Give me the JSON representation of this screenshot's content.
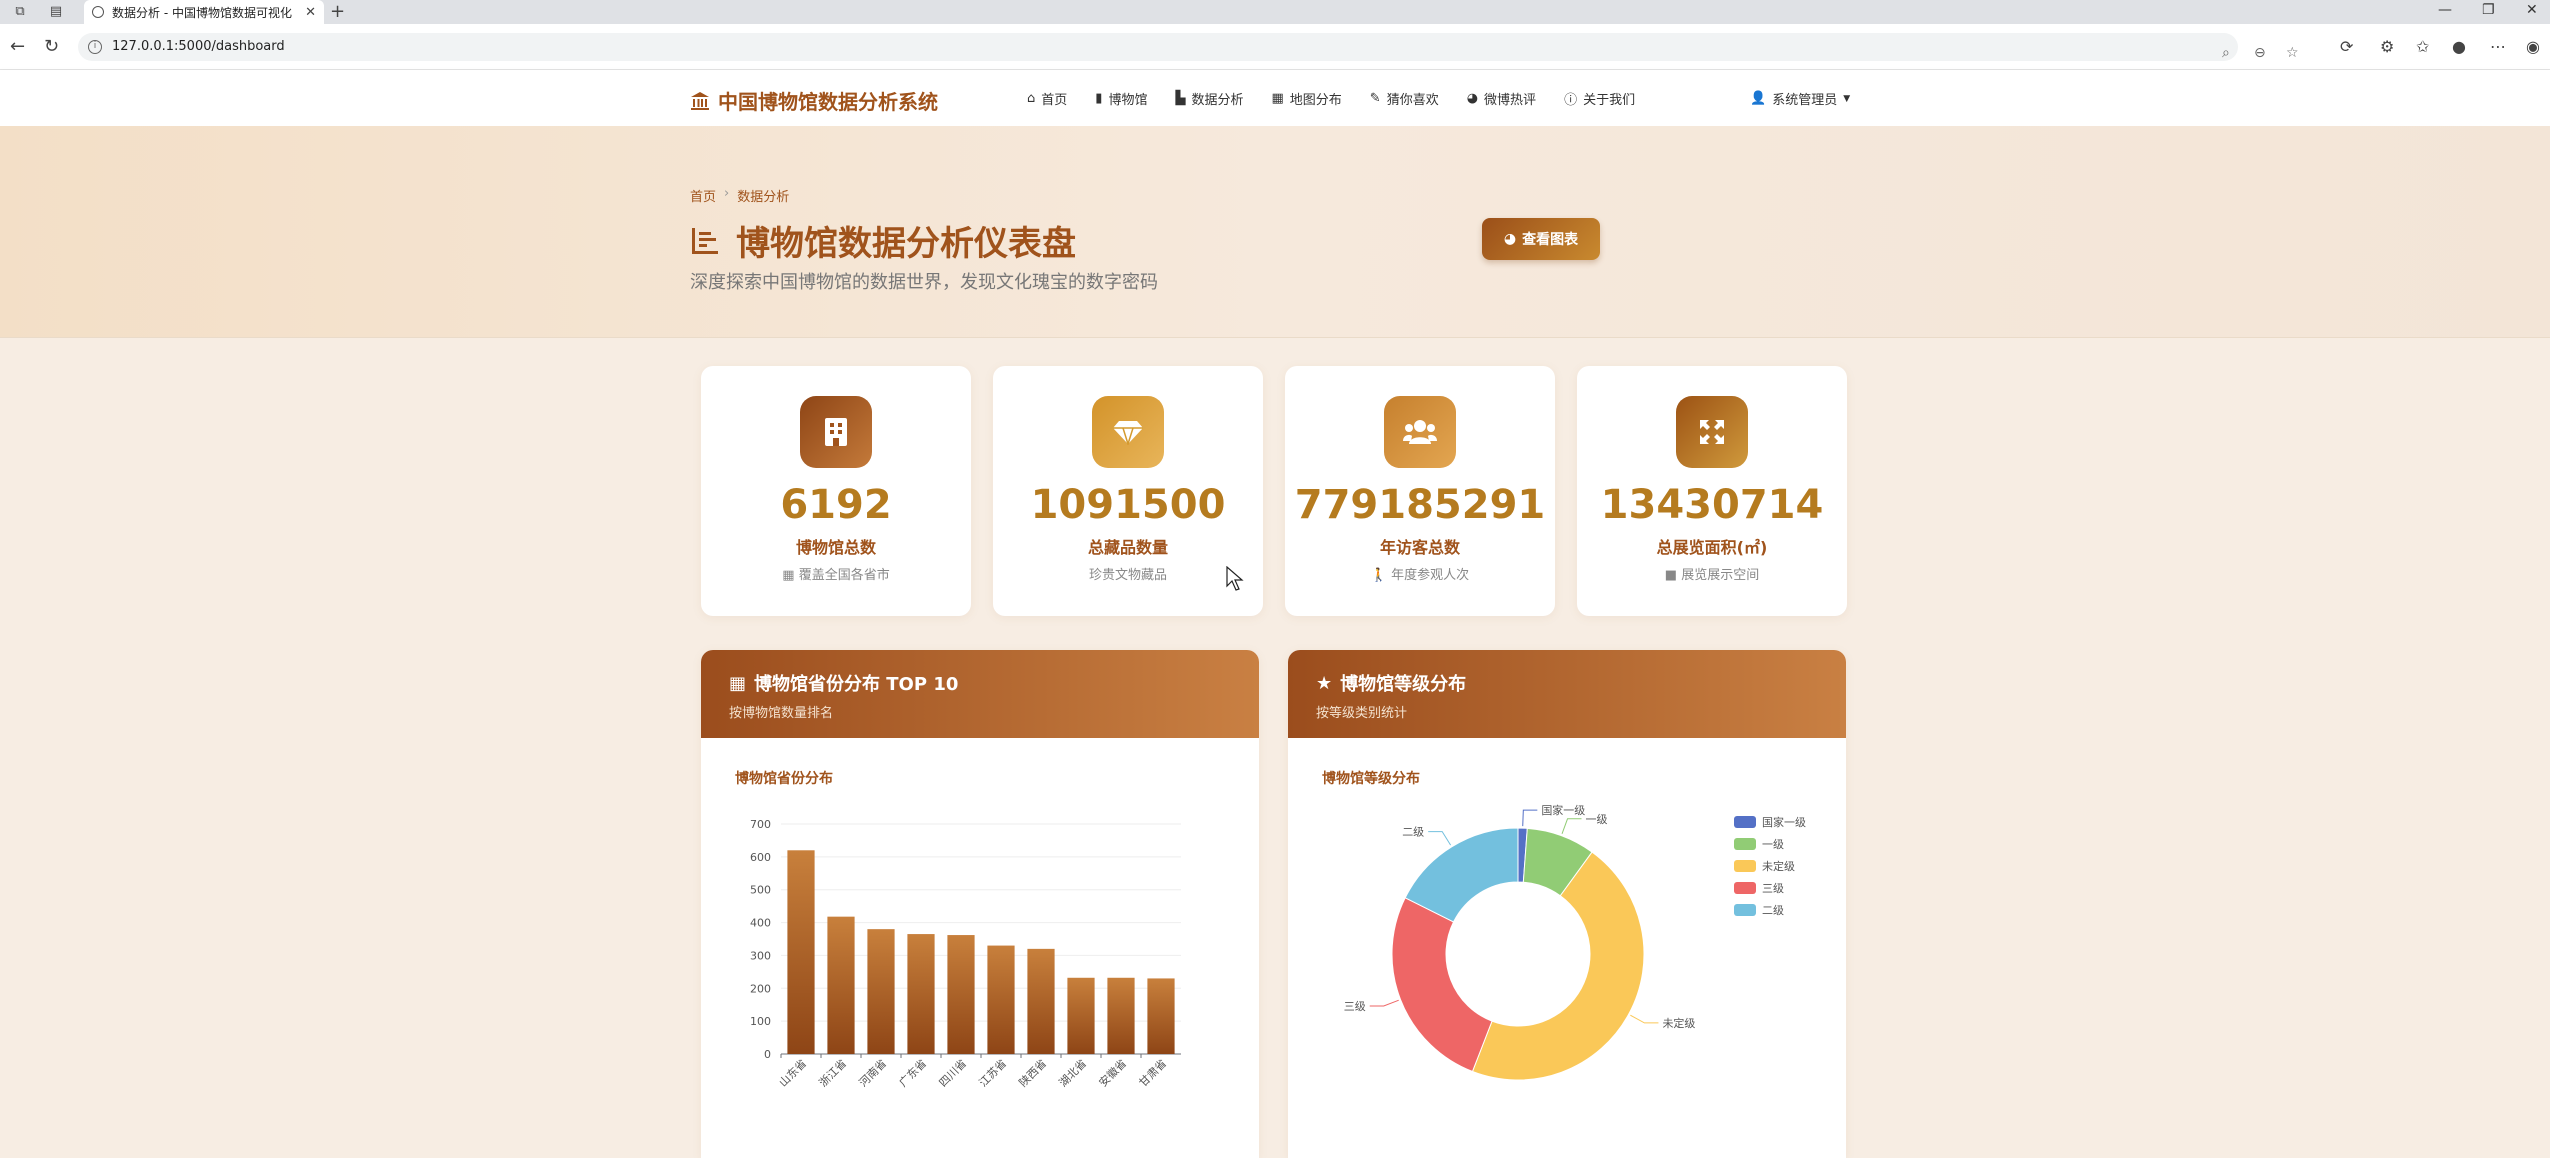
{
  "browser": {
    "tab_title": "数据分析 - 中国博物馆数据可视化",
    "url": "127.0.0.1:5000/dashboard"
  },
  "site": {
    "brand": "中国博物馆数据分析系统",
    "nav": [
      "首页",
      "博物馆",
      "数据分析",
      "地图分布",
      "猜你喜欢",
      "微博热评",
      "关于我们"
    ],
    "user": "系统管理员"
  },
  "hero": {
    "breadcrumb_home": "首页",
    "breadcrumb_current": "数据分析",
    "title": "博物馆数据分析仪表盘",
    "subtitle": "深度探索中国博物馆的数据世界，发现文化瑰宝的数字密码",
    "view_button": "查看图表"
  },
  "stats": [
    {
      "value": "6192",
      "label": "博物馆总数",
      "note": "覆盖全国各省市",
      "icon": "building-icon",
      "color": "#a0531c"
    },
    {
      "value": "1091500",
      "label": "总藏品数量",
      "note": "珍贵文物藏品",
      "icon": "gem-icon",
      "color": "#d49a2f"
    },
    {
      "value": "779185291",
      "label": "年访客总数",
      "note": "年度参观人次",
      "icon": "users-icon",
      "color": "#d08a35"
    },
    {
      "value": "13430714",
      "label": "总展览面积(㎡)",
      "note": "展览展示空间",
      "icon": "expand-icon",
      "color": "#b06a1a"
    }
  ],
  "panels": {
    "province": {
      "title": "博物馆省份分布 TOP 10",
      "subtitle": "按博物馆数量排名",
      "chart_title": "博物馆省份分布"
    },
    "level": {
      "title": "博物馆等级分布",
      "subtitle": "按等级类别统计",
      "chart_title": "博物馆等级分布"
    }
  },
  "chart_data": [
    {
      "type": "bar",
      "title": "博物馆省份分布",
      "categories": [
        "山东省",
        "浙江省",
        "河南省",
        "广东省",
        "四川省",
        "江苏省",
        "陕西省",
        "湖北省",
        "安徽省",
        "甘肃省"
      ],
      "values": [
        620,
        418,
        380,
        365,
        362,
        330,
        320,
        232,
        232,
        230
      ],
      "ylim": [
        0,
        700
      ],
      "yticks": [
        0,
        100,
        200,
        300,
        400,
        500,
        600,
        700
      ],
      "grid": true,
      "color": "#b5651d"
    },
    {
      "type": "pie",
      "title": "博物馆等级分布",
      "legend_position": "top-right",
      "slices": [
        {
          "label": "国家一级",
          "value": 2,
          "color": "#5470c6"
        },
        {
          "label": "一级",
          "value": 15,
          "color": "#91cc75"
        },
        {
          "label": "未定级",
          "value": 78,
          "color": "#fac858"
        },
        {
          "label": "三级",
          "value": 45,
          "color": "#ee6666"
        },
        {
          "label": "二级",
          "value": 30,
          "color": "#73c0de"
        }
      ]
    }
  ]
}
